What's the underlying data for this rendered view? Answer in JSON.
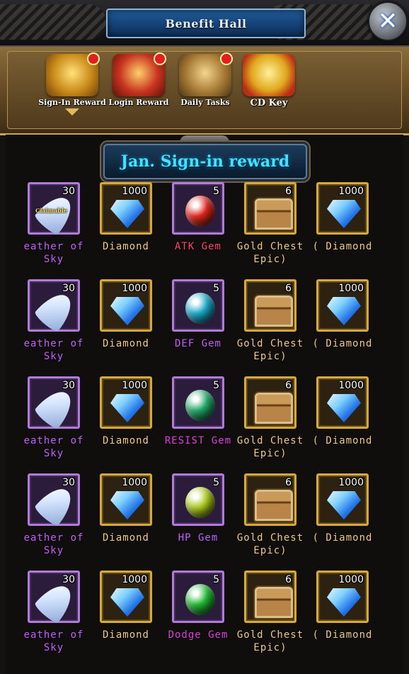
{
  "header": {
    "title": "Benefit Hall",
    "close_glyph": "✕"
  },
  "tabs": [
    {
      "label": "Sign-In Reward",
      "icon": "treasure-chest-icon",
      "active": true,
      "badge": true
    },
    {
      "label": "Login Reward",
      "icon": "red-chest-icon",
      "active": false,
      "badge": true
    },
    {
      "label": "Daily Tasks",
      "icon": "scroll-icon",
      "active": false,
      "badge": true
    },
    {
      "label": "CD Key",
      "icon": "gift-box-icon",
      "active": false,
      "badge": false
    }
  ],
  "banner": {
    "title": "Jan. Sign-in reward"
  },
  "claim_text": "Claimable",
  "rows": [
    [
      {
        "name": "eather of\nSky",
        "qty": "30",
        "rarity": "purple",
        "item": "feather",
        "claimable": true
      },
      {
        "name": "Diamond",
        "qty": "1000",
        "rarity": "gold",
        "item": "diamond"
      },
      {
        "name": "ATK Gem",
        "qty": "5",
        "rarity": "purple",
        "item": "gem",
        "gem_color": "#e0251a",
        "name_color": "red"
      },
      {
        "name": "Gold Chest\nEpic)",
        "qty": "6",
        "rarity": "gold",
        "item": "chest"
      },
      {
        "name": "( Diamond",
        "qty": "1000",
        "rarity": "gold",
        "item": "diamond"
      }
    ],
    [
      {
        "name": "eather of\nSky",
        "qty": "30",
        "rarity": "purple",
        "item": "feather"
      },
      {
        "name": "Diamond",
        "qty": "1000",
        "rarity": "gold",
        "item": "diamond"
      },
      {
        "name": "DEF Gem",
        "qty": "5",
        "rarity": "purple",
        "item": "gem",
        "gem_color": "#18a8c8",
        "name_color": "purple"
      },
      {
        "name": "Gold Chest\nEpic)",
        "qty": "6",
        "rarity": "gold",
        "item": "chest"
      },
      {
        "name": "( Diamond",
        "qty": "1000",
        "rarity": "gold",
        "item": "diamond"
      }
    ],
    [
      {
        "name": "eather of\nSky",
        "qty": "30",
        "rarity": "purple",
        "item": "feather"
      },
      {
        "name": "Diamond",
        "qty": "1000",
        "rarity": "gold",
        "item": "diamond"
      },
      {
        "name": "RESIST Gem",
        "qty": "5",
        "rarity": "purple",
        "item": "gem",
        "gem_color": "#1fa86a",
        "name_color": "mag"
      },
      {
        "name": "Gold Chest\nEpic)",
        "qty": "6",
        "rarity": "gold",
        "item": "chest"
      },
      {
        "name": "( Diamond",
        "qty": "1000",
        "rarity": "gold",
        "item": "diamond"
      }
    ],
    [
      {
        "name": "eather of\nSky",
        "qty": "30",
        "rarity": "purple",
        "item": "feather"
      },
      {
        "name": "Diamond",
        "qty": "1000",
        "rarity": "gold",
        "item": "diamond"
      },
      {
        "name": "HP Gem",
        "qty": "5",
        "rarity": "purple",
        "item": "gem",
        "gem_color": "#a8c818",
        "name_color": "purple"
      },
      {
        "name": "Gold Chest\nEpic)",
        "qty": "6",
        "rarity": "gold",
        "item": "chest"
      },
      {
        "name": "( Diamond",
        "qty": "1000",
        "rarity": "gold",
        "item": "diamond"
      }
    ],
    [
      {
        "name": "eather of\nSky",
        "qty": "30",
        "rarity": "purple",
        "item": "feather"
      },
      {
        "name": "Diamond",
        "qty": "1000",
        "rarity": "gold",
        "item": "diamond"
      },
      {
        "name": "Dodge Gem",
        "qty": "5",
        "rarity": "purple",
        "item": "gem",
        "gem_color": "#20b830",
        "name_color": "mag"
      },
      {
        "name": "Gold Chest\nEpic)",
        "qty": "6",
        "rarity": "gold",
        "item": "chest"
      },
      {
        "name": "( Diamond",
        "qty": "1000",
        "rarity": "gold",
        "item": "diamond"
      }
    ]
  ],
  "colors": {
    "purple_frame": "#b27bd9",
    "gold_frame": "#d7a83a",
    "banner_text": "#45e1ff"
  }
}
